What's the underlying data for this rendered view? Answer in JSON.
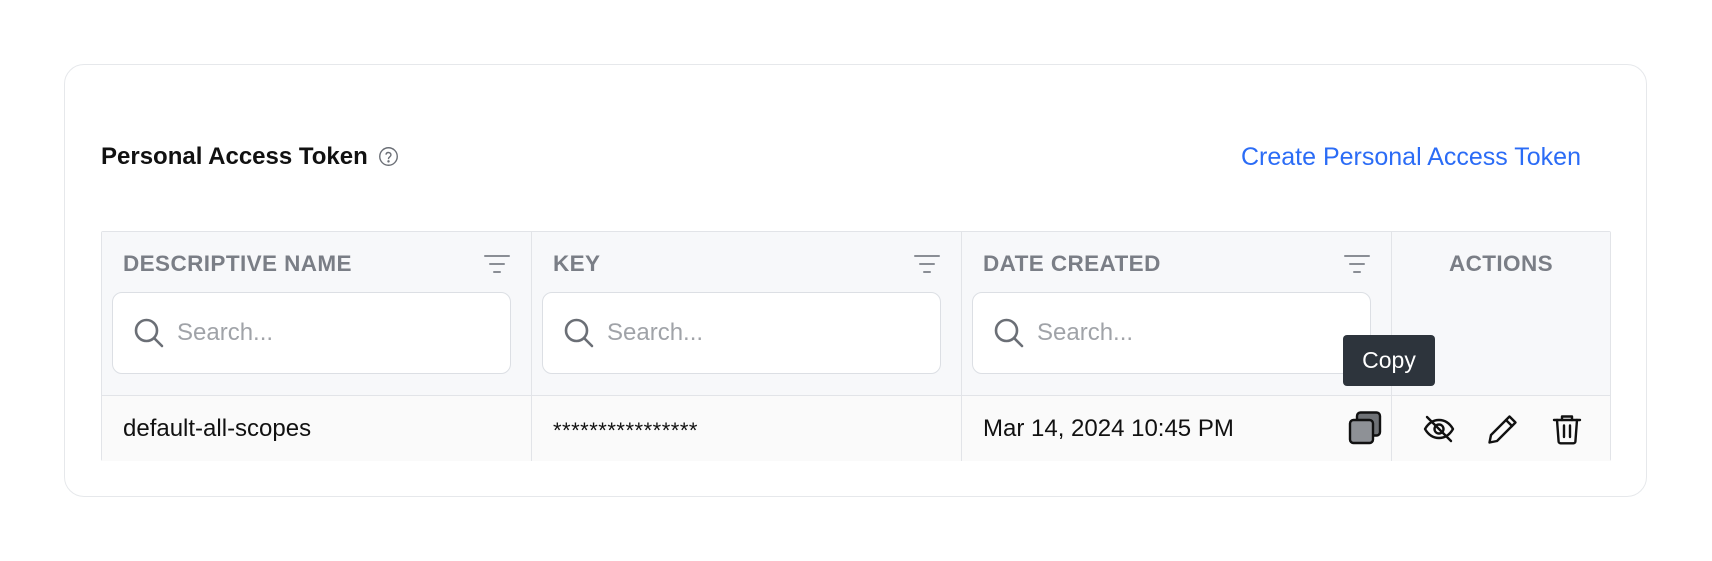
{
  "section": {
    "title": "Personal Access Token",
    "create_link": "Create Personal Access Token"
  },
  "table": {
    "columns": [
      {
        "label": "DESCRIPTIVE NAME",
        "placeholder": "Search..."
      },
      {
        "label": "KEY",
        "placeholder": "Search..."
      },
      {
        "label": "DATE CREATED",
        "placeholder": "Search..."
      },
      {
        "label": "ACTIONS"
      }
    ],
    "rows": [
      {
        "name": "default-all-scopes",
        "key": "****************",
        "date_created": "Mar 14, 2024 10:45 PM"
      }
    ]
  },
  "tooltip": {
    "text": "Copy"
  },
  "icons": {
    "help": "question-circle-icon",
    "filter": "filter-lines-icon",
    "search": "search-icon",
    "copy": "copy-icon",
    "visibility": "eye-off-icon",
    "edit": "pencil-icon",
    "delete": "trash-icon"
  },
  "colors": {
    "link": "#2b6cf6",
    "header_text": "#7a7e86",
    "tooltip_bg": "#2d343c",
    "table_header_bg": "#f7f8fa"
  }
}
